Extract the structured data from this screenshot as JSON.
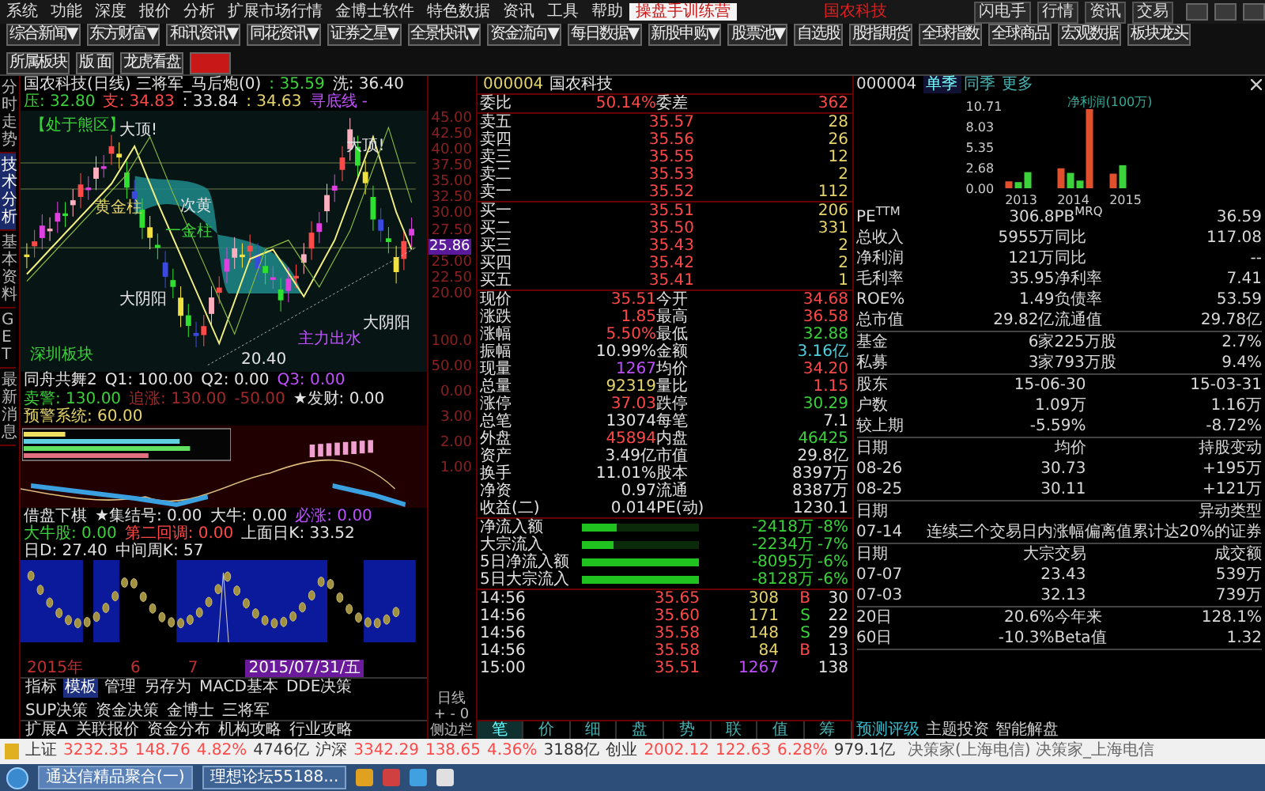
{
  "menu": {
    "items": [
      "系统",
      "功能",
      "深度",
      "报价",
      "分析",
      "扩展市场行情",
      "金博士软件",
      "特色数据",
      "资讯",
      "工具",
      "帮助"
    ],
    "highlight": "操盘手训练营",
    "notice": "国农科技",
    "right_buttons": [
      "闪电手",
      "行情",
      "资讯",
      "交易"
    ]
  },
  "toolbar": {
    "dropdowns": [
      "综合新闻▼",
      "东方财富▼",
      "和讯资讯▼",
      "同花资讯▼",
      "证券之星▼",
      "全景快讯▼",
      "资金流向▼",
      "每日数据▼",
      "新股申购▼",
      "股票池▼"
    ],
    "buttons": [
      "自选股",
      "股指期货",
      "全球指数",
      "全球商品",
      "宏观数据",
      "板块龙头",
      "所属板块",
      "版 面",
      "龙虎看盘"
    ]
  },
  "side_tabs": [
    {
      "label": "分时走势",
      "selected": false
    },
    {
      "label": "技术分析",
      "selected": true
    },
    {
      "label": "基本资料",
      "selected": false
    },
    {
      "label": "GET",
      "selected": false
    },
    {
      "label": "最新消息",
      "selected": false
    }
  ],
  "chart_header": [
    {
      "text": "国农科技(日线) 三将军_马后炮(0)",
      "kind": "plain"
    },
    {
      "text": ": 35.59",
      "kind": "down"
    },
    {
      "text": "洗: 36.40",
      "kind": "plain"
    },
    {
      "text": "压: 32.80",
      "kind": "down"
    },
    {
      "text": "支: 34.83",
      "kind": "up"
    },
    {
      "text": ": 33.84",
      "kind": "plain"
    },
    {
      "text": ": 34.63",
      "kind": "volume"
    },
    {
      "text": "寻底线 -",
      "kind": "tick"
    }
  ],
  "chart_labels": [
    {
      "text": "【处于熊区】",
      "kind": "down"
    },
    {
      "text": "大顶!",
      "kind": "plain"
    },
    {
      "text": "大顶!",
      "kind": "plain"
    },
    {
      "text": "黄金柱",
      "kind": "volume"
    },
    {
      "text": "大阴阳",
      "kind": "plain"
    },
    {
      "text": "次黄",
      "kind": "plain"
    },
    {
      "text": "一金柱",
      "kind": "down"
    },
    {
      "text": "主力出水",
      "kind": "tick"
    },
    {
      "text": "大阴阳",
      "kind": "plain"
    },
    {
      "text": "深圳板块",
      "kind": "down"
    },
    {
      "text": "20.40",
      "kind": "plain"
    }
  ],
  "indicator_1": [
    {
      "text": "同舟共舞2",
      "kind": "plain"
    },
    {
      "text": "Q1: 100.00",
      "kind": "plain"
    },
    {
      "text": "Q2: 0.00",
      "kind": "plain"
    },
    {
      "text": "Q3: 0.00",
      "kind": "tick"
    },
    {
      "text": "卖警: 130.00",
      "kind": "down"
    },
    {
      "text": "追涨: 130.00",
      "kind": "dim"
    },
    {
      "text": "-50.00",
      "kind": "dim"
    },
    {
      "text": "★发财: 0.00",
      "kind": "plain"
    },
    {
      "text": "预警系统: 60.00",
      "kind": "volume"
    }
  ],
  "indicator_2": [
    {
      "text": "借盘下棋",
      "kind": "plain"
    },
    {
      "text": "★集结号: 0.00",
      "kind": "plain"
    },
    {
      "text": "大牛: 0.00",
      "kind": "plain"
    },
    {
      "text": "必涨: 0.00",
      "kind": "tick"
    },
    {
      "text": "大牛股: 0.00",
      "kind": "down"
    },
    {
      "text": "第二回调: 0.00",
      "kind": "up"
    },
    {
      "text": "上面日K: 33.52",
      "kind": "plain"
    },
    {
      "text": "日D: 27.40",
      "kind": "plain"
    },
    {
      "text": "中间周K: 57",
      "kind": "plain"
    }
  ],
  "date_axis": [
    "2015年",
    "6",
    "7"
  ],
  "date_cursor": "2015/07/31/五",
  "bottom_tabs": [
    {
      "label": "指标",
      "selected": false
    },
    {
      "label": "模板",
      "selected": true
    },
    {
      "label": "管理",
      "selected": false
    },
    {
      "label": "另存为",
      "selected": false
    },
    {
      "label": "MACD基本",
      "selected": false
    },
    {
      "label": "DDE决策",
      "selected": false
    },
    {
      "label": "SUP决策",
      "selected": false
    },
    {
      "label": "资金决策",
      "selected": false
    },
    {
      "label": "金博士",
      "selected": false
    },
    {
      "label": "三将军",
      "selected": false
    }
  ],
  "bottom_tabs_2": [
    "扩展A",
    "关联报价",
    "资金分布",
    "机构攻略",
    "行业攻略"
  ],
  "price_axis": [
    "45.00",
    "42.50",
    "40.00",
    "37.50",
    "35.00",
    "32.50",
    "30.00",
    "27.50",
    "25.00",
    "22.50",
    "20.00"
  ],
  "price_tag": "25.86",
  "lower_axis": [
    "100.0",
    "50.00",
    "0.00",
    "3.00",
    "2.00",
    "1.00"
  ],
  "axis_footer": [
    "日线",
    "+ - 0",
    "侧边栏"
  ],
  "quote": {
    "code": "000004",
    "name": "国农科技",
    "ratio_label": "委比",
    "ratio": "50.14%",
    "diff_label": "委差",
    "diff": "362",
    "asks": [
      {
        "label": "卖五",
        "price": "35.57",
        "volume": "28"
      },
      {
        "label": "卖四",
        "price": "35.56",
        "volume": "26"
      },
      {
        "label": "卖三",
        "price": "35.55",
        "volume": "12"
      },
      {
        "label": "卖二",
        "price": "35.53",
        "volume": "2"
      },
      {
        "label": "卖一",
        "price": "35.52",
        "volume": "112"
      }
    ],
    "bids": [
      {
        "label": "买一",
        "price": "35.51",
        "volume": "206"
      },
      {
        "label": "买二",
        "price": "35.50",
        "volume": "331"
      },
      {
        "label": "买三",
        "price": "35.43",
        "volume": "2"
      },
      {
        "label": "买四",
        "price": "35.42",
        "volume": "2"
      },
      {
        "label": "买五",
        "price": "35.41",
        "volume": "1"
      }
    ],
    "stats": [
      [
        {
          "label": "现价",
          "value": "35.51",
          "kind": "up"
        },
        {
          "label": "今开",
          "value": "34.68",
          "kind": "up"
        }
      ],
      [
        {
          "label": "涨跌",
          "value": "1.85",
          "kind": "up"
        },
        {
          "label": "最高",
          "value": "36.58",
          "kind": "up"
        }
      ],
      [
        {
          "label": "涨幅",
          "value": "5.50%",
          "kind": "up"
        },
        {
          "label": "最低",
          "value": "32.88",
          "kind": "down"
        }
      ],
      [
        {
          "label": "振幅",
          "value": "10.99%",
          "kind": "plain"
        },
        {
          "label": "金额",
          "value": "3.16亿",
          "kind": "amount"
        }
      ],
      [
        {
          "label": "现量",
          "value": "1267",
          "kind": "tick"
        },
        {
          "label": "均价",
          "value": "34.20",
          "kind": "up"
        }
      ],
      [
        {
          "label": "总量",
          "value": "92319",
          "kind": "volume"
        },
        {
          "label": "量比",
          "value": "1.15",
          "kind": "up"
        }
      ],
      [
        {
          "label": "涨停",
          "value": "37.03",
          "kind": "up"
        },
        {
          "label": "跌停",
          "value": "30.29",
          "kind": "down"
        }
      ],
      [
        {
          "label": "总笔",
          "value": "13074",
          "kind": "plain"
        },
        {
          "label": "每笔",
          "value": "7.1",
          "kind": "plain"
        }
      ],
      [
        {
          "label": "外盘",
          "value": "45894",
          "kind": "up"
        },
        {
          "label": "内盘",
          "value": "46425",
          "kind": "down"
        }
      ],
      [
        {
          "label": "资产",
          "value": "3.49亿",
          "kind": "plain"
        },
        {
          "label": "市值",
          "value": "29.8亿",
          "kind": "plain"
        }
      ],
      [
        {
          "label": "换手",
          "value": "11.01%",
          "kind": "plain"
        },
        {
          "label": "股本",
          "value": "8397万",
          "kind": "plain"
        }
      ],
      [
        {
          "label": "净资",
          "value": "0.97",
          "kind": "plain"
        },
        {
          "label": "流通",
          "value": "8387万",
          "kind": "plain"
        }
      ],
      [
        {
          "label": "收益(二)",
          "value": "0.014",
          "kind": "plain"
        },
        {
          "label": "PE(动)",
          "value": "1230.1",
          "kind": "plain"
        }
      ]
    ],
    "flows": [
      {
        "label": "净流入额",
        "level": 0.3,
        "amount": "-2418万",
        "pct": "-8%"
      },
      {
        "label": "大宗流入",
        "level": 0.28,
        "amount": "-2234万",
        "pct": "-7%"
      },
      {
        "label": "5日净流入额",
        "level": 1.0,
        "amount": "-8095万",
        "pct": "-6%"
      },
      {
        "label": "5日大宗流入",
        "level": 1.0,
        "amount": "-8128万",
        "pct": "-6%"
      }
    ],
    "ticks": [
      {
        "time": "14:56",
        "price": "35.65",
        "volume": "308",
        "kind": "volume",
        "side": "B",
        "count": "30"
      },
      {
        "time": "14:56",
        "price": "35.60",
        "volume": "171",
        "kind": "volume",
        "side": "S",
        "count": "22"
      },
      {
        "time": "14:56",
        "price": "35.58",
        "volume": "148",
        "kind": "volume",
        "side": "S",
        "count": "29"
      },
      {
        "time": "14:56",
        "price": "35.58",
        "volume": "84",
        "kind": "volume",
        "side": "B",
        "count": "13"
      },
      {
        "time": "15:00",
        "price": "35.51",
        "volume": "1267",
        "kind": "tick",
        "count": "138"
      }
    ],
    "tabs": [
      {
        "label": "笔",
        "selected": true
      },
      {
        "label": "价",
        "selected": false
      },
      {
        "label": "细",
        "selected": false
      },
      {
        "label": "盘",
        "selected": false
      },
      {
        "label": "势",
        "selected": false
      },
      {
        "label": "联",
        "selected": false
      },
      {
        "label": "值",
        "selected": false
      },
      {
        "label": "筹",
        "selected": false
      }
    ]
  },
  "f10": {
    "code": "000004",
    "tabs": [
      {
        "label": "单季",
        "selected": true
      },
      {
        "label": "同季",
        "selected": false
      },
      {
        "label": "更多",
        "selected": false
      }
    ],
    "chart_data": {
      "type": "bar",
      "title": "净利润(100万)",
      "categories": [
        "2013",
        "2014",
        "2015"
      ],
      "series": [
        {
          "color": "#e0502c",
          "values": [
            0.9,
            2.6,
            1.9
          ]
        },
        {
          "color": "#3cd23c",
          "values": [
            0.8,
            2.0,
            3.0
          ]
        },
        {
          "color": "#3cd23c",
          "values": [
            2.1,
            1.0,
            null
          ]
        },
        {
          "color": "#e0502c",
          "values": [
            null,
            10.3,
            null
          ]
        }
      ],
      "ylim": [
        0,
        10.71
      ],
      "yticks": [
        {
          "value": 0,
          "label": "0.00"
        },
        {
          "value": 2.68,
          "label": "2.68"
        },
        {
          "value": 5.35,
          "label": "5.35"
        },
        {
          "value": 8.03,
          "label": "8.03"
        },
        {
          "value": 10.71,
          "label": "10.71"
        }
      ]
    },
    "sections": [
      [
        [
          "PE$^{TTM}$",
          "306.8",
          "PB$^{MRQ}$",
          "36.59"
        ],
        [
          "总收入",
          "5955万",
          "同比",
          "117.08"
        ],
        [
          "净利润",
          "121万",
          "同比",
          "--"
        ],
        [
          "毛利率",
          "35.95",
          "净利率",
          "7.41"
        ],
        [
          "ROE%",
          "1.49",
          "负债率",
          "53.59"
        ],
        [
          "总市值",
          "29.82亿",
          "流通值",
          "29.78亿"
        ]
      ],
      [
        [
          "基金",
          "6家",
          "225万股",
          "2.7%"
        ],
        [
          "私募",
          "3家",
          "793万股",
          "9.4%"
        ]
      ],
      [
        [
          "股东",
          "15-06-30",
          "15-03-31"
        ],
        [
          "户数",
          "1.09万",
          "1.16万"
        ],
        [
          "较上期",
          "-5.59%",
          "-8.72%"
        ]
      ],
      [
        [
          "日期",
          "均价",
          "持股变动"
        ],
        [
          "08-26",
          "30.73",
          "+195万"
        ],
        [
          "08-25",
          "30.11",
          "+121万"
        ]
      ],
      [
        [
          "日期",
          "异动类型"
        ],
        [
          "07-14",
          "连续三个交易日内涨幅偏离值累计达20%的证券"
        ]
      ],
      [
        [
          "日期",
          "大宗交易",
          "成交额"
        ],
        [
          "07-07",
          "23.43",
          "539万"
        ],
        [
          "07-03",
          "32.13",
          "739万"
        ]
      ],
      [
        [
          "20日",
          "20.6%",
          "今年来",
          "128.1%"
        ],
        [
          "60日",
          "-10.3%",
          "Beta值",
          "1.32"
        ]
      ]
    ],
    "links": [
      "预测评级",
      "主题投资",
      "智能解盘"
    ]
  },
  "ticker": [
    {
      "name": "上证",
      "value": "3232.35",
      "change": "148.76",
      "pct": "4.82%",
      "amount": "4746亿"
    },
    {
      "name": "沪深",
      "value": "3342.29",
      "change": "138.65",
      "pct": "4.36%",
      "amount": "3188亿"
    },
    {
      "name": "创业",
      "value": "2002.12",
      "change": "122.63",
      "pct": "6.28%",
      "amount": "979.1亿"
    }
  ],
  "status_text": "决策家(上海电信) 决策家_上海电信",
  "taskbar": {
    "windows": [
      {
        "label": "通达信精品聚合(一)",
        "selected": true
      },
      {
        "label": "理想论坛55188...",
        "selected": false
      }
    ]
  }
}
